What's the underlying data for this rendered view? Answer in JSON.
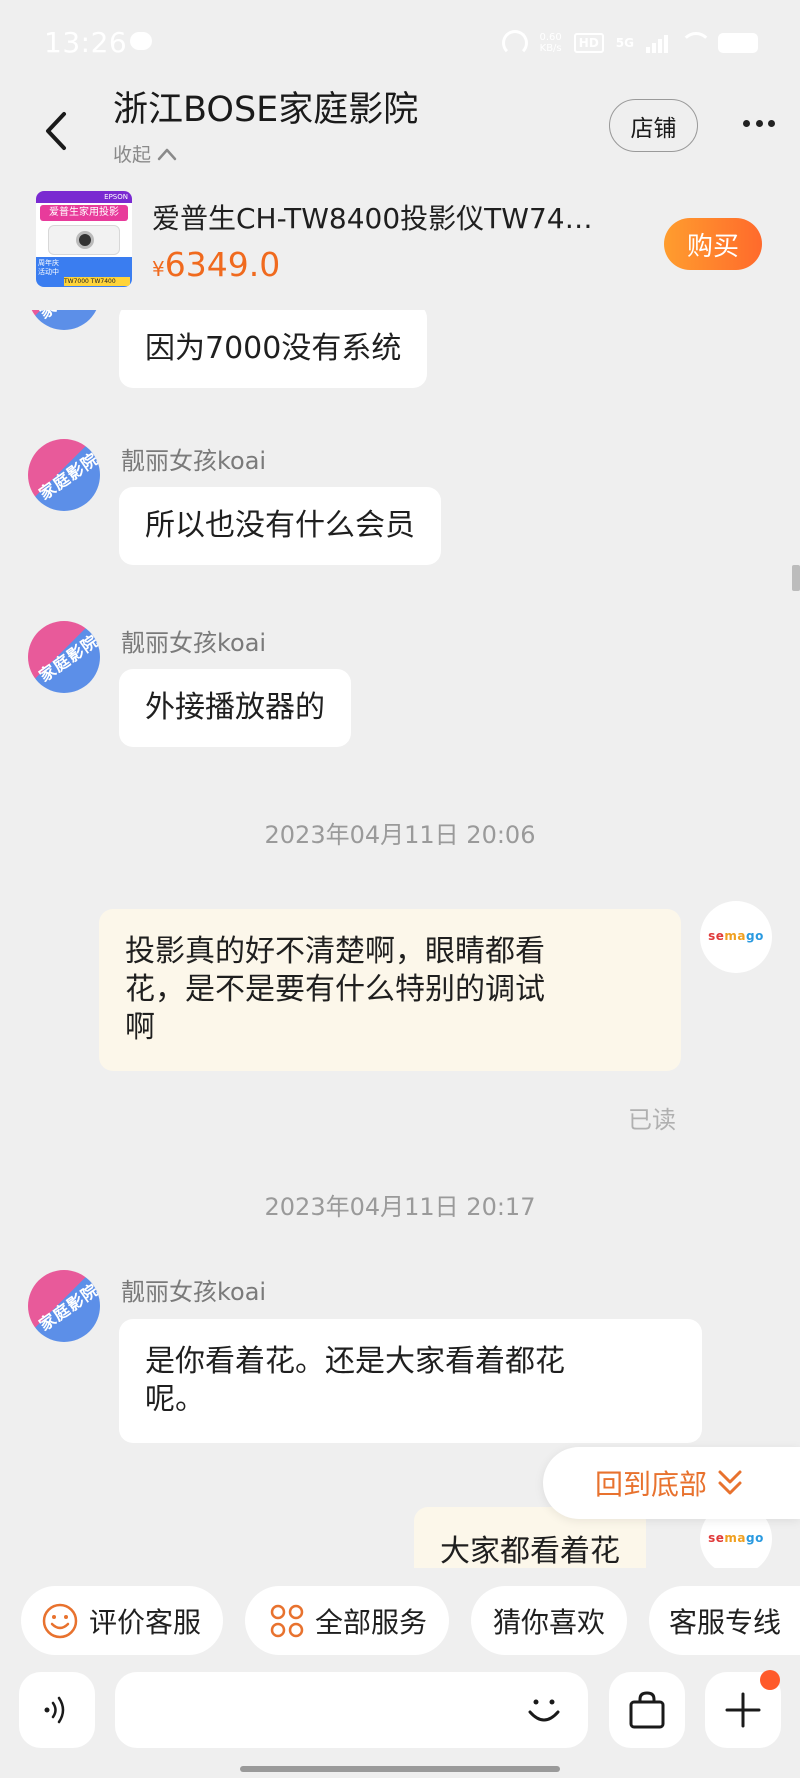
{
  "status_bar": {
    "time": "13:26",
    "net_speed_value": "0.60",
    "net_speed_unit": "KB/s",
    "hd_label": "HD",
    "network_label": "5G"
  },
  "header": {
    "title": "浙江BOSE家庭影院",
    "collapse_label": "收起",
    "shop_label": "店铺"
  },
  "product": {
    "thumb_brand": "EPSON",
    "thumb_title": "爱普生家用投影",
    "thumb_badge": "周年庆活动中",
    "thumb_models": "TW7000 TW7400",
    "title": "爱普生CH-TW8400投影仪TW74…",
    "price_symbol": "¥",
    "price": "6349.0",
    "buy_label": "购买"
  },
  "chat": {
    "shop_avatar_text": "家庭影院",
    "user_avatar_text": [
      "se",
      "ma",
      "go"
    ],
    "messages": [
      {
        "sender": "",
        "text": "因为7000没有系统"
      },
      {
        "sender": "靓丽女孩koai",
        "text": "所以也没有什么会员"
      },
      {
        "sender": "靓丽女孩koai",
        "text": "外接播放器的"
      },
      {
        "timestamp": "2023年04月11日 20:06"
      },
      {
        "text": "投影真的好不清楚啊，眼睛都看\n花，是不是要有什么特别的调试\n啊",
        "read": "已读"
      },
      {
        "timestamp": "2023年04月11日 20:17"
      },
      {
        "sender": "靓丽女孩koai",
        "text": "是你看着花。还是大家看着都花\n呢。"
      },
      {
        "text": "大家都看着花"
      }
    ],
    "back_to_bottom_label": "回到底部"
  },
  "quick_actions": [
    {
      "label": "评价客服",
      "icon": "smile-icon"
    },
    {
      "label": "全部服务",
      "icon": "grid-icon"
    },
    {
      "label": "猜你喜欢"
    },
    {
      "label": "客服专线"
    }
  ],
  "input_bar": {
    "placeholder": ""
  },
  "colors": {
    "accent": "#f06a1e",
    "buy_gradient_start": "#ff9d2e",
    "buy_gradient_end": "#ff6a2c",
    "background": "#efefef",
    "user_bubble": "#fcf7ea",
    "back_to_bottom_text": "#e8722e"
  }
}
